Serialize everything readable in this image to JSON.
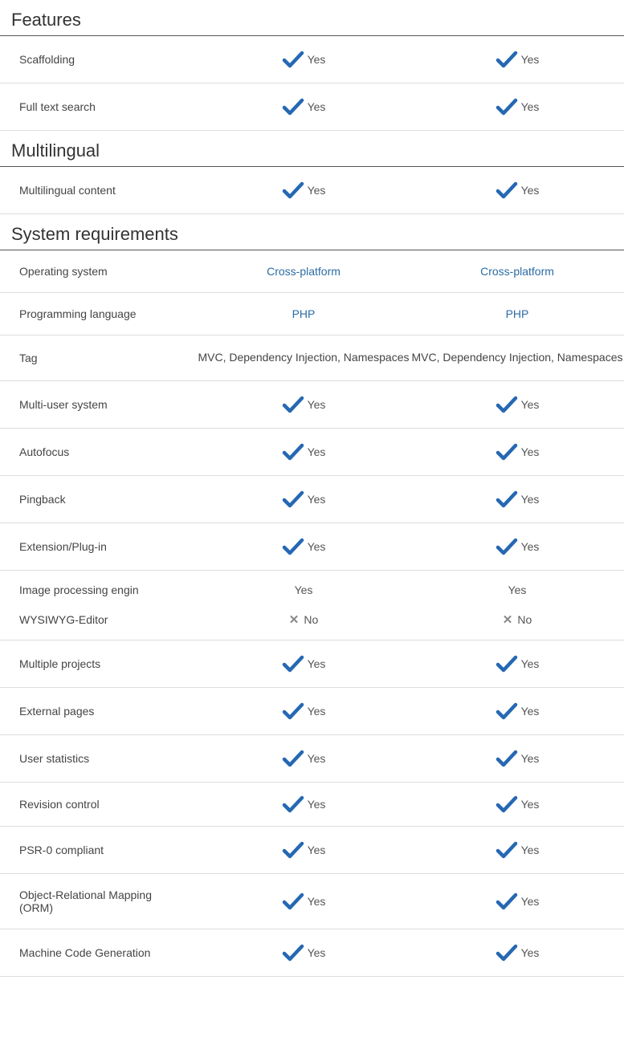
{
  "strings": {
    "yes": "Yes",
    "no": "No"
  },
  "sections": {
    "features": {
      "title": "Features",
      "rows": {
        "scaffolding": {
          "label": "Scaffolding",
          "c1": {
            "t": "yes"
          },
          "c2": {
            "t": "yes"
          }
        },
        "fulltext": {
          "label": "Full text search",
          "c1": {
            "t": "yes"
          },
          "c2": {
            "t": "yes"
          }
        }
      }
    },
    "multilingual": {
      "title": "Multilingual",
      "rows": {
        "content": {
          "label": "Multilingual content",
          "c1": {
            "t": "yes"
          },
          "c2": {
            "t": "yes"
          }
        }
      }
    },
    "sysreq": {
      "title": "System requirements",
      "rows": {
        "os": {
          "label": "Operating system",
          "c1": {
            "t": "link",
            "v": "Cross-platform"
          },
          "c2": {
            "t": "link",
            "v": "Cross-platform"
          }
        },
        "lang": {
          "label": "Programming language",
          "c1": {
            "t": "link",
            "v": "PHP"
          },
          "c2": {
            "t": "link",
            "v": "PHP"
          }
        },
        "tag": {
          "label": "Tag",
          "c1": {
            "t": "text",
            "v": "MVC, Dependency Injection, Namespaces"
          },
          "c2": {
            "t": "text",
            "v": "MVC, Dependency Injection, Namespaces"
          }
        },
        "multiuser": {
          "label": "Multi-user system",
          "c1": {
            "t": "yes"
          },
          "c2": {
            "t": "yes"
          }
        },
        "autofocus": {
          "label": "Autofocus",
          "c1": {
            "t": "yes"
          },
          "c2": {
            "t": "yes"
          }
        },
        "pingback": {
          "label": "Pingback",
          "c1": {
            "t": "yes"
          },
          "c2": {
            "t": "yes"
          }
        },
        "plugin": {
          "label": "Extension/Plug-in",
          "c1": {
            "t": "yes"
          },
          "c2": {
            "t": "yes"
          }
        },
        "imgproc": {
          "label": "Image processing engin",
          "c1": {
            "t": "plain",
            "v": "Yes"
          },
          "c2": {
            "t": "plain",
            "v": "Yes"
          }
        },
        "wysiwyg": {
          "label": "WYSIWYG-Editor",
          "c1": {
            "t": "no"
          },
          "c2": {
            "t": "no"
          }
        },
        "projects": {
          "label": "Multiple projects",
          "c1": {
            "t": "yes"
          },
          "c2": {
            "t": "yes"
          }
        },
        "extpages": {
          "label": "External pages",
          "c1": {
            "t": "yes"
          },
          "c2": {
            "t": "yes"
          }
        },
        "stats": {
          "label": "User statistics",
          "c1": {
            "t": "yes"
          },
          "c2": {
            "t": "yes"
          }
        },
        "revision": {
          "label": "Revision control",
          "c1": {
            "t": "yes"
          },
          "c2": {
            "t": "yes"
          }
        },
        "psr0": {
          "label": "PSR-0 compliant",
          "c1": {
            "t": "yes"
          },
          "c2": {
            "t": "yes"
          }
        },
        "orm": {
          "label": "Object-Relational Mapping (ORM)",
          "c1": {
            "t": "yes"
          },
          "c2": {
            "t": "yes"
          }
        },
        "codegen": {
          "label": "Machine Code Generation",
          "c1": {
            "t": "yes"
          },
          "c2": {
            "t": "yes"
          }
        }
      }
    }
  }
}
